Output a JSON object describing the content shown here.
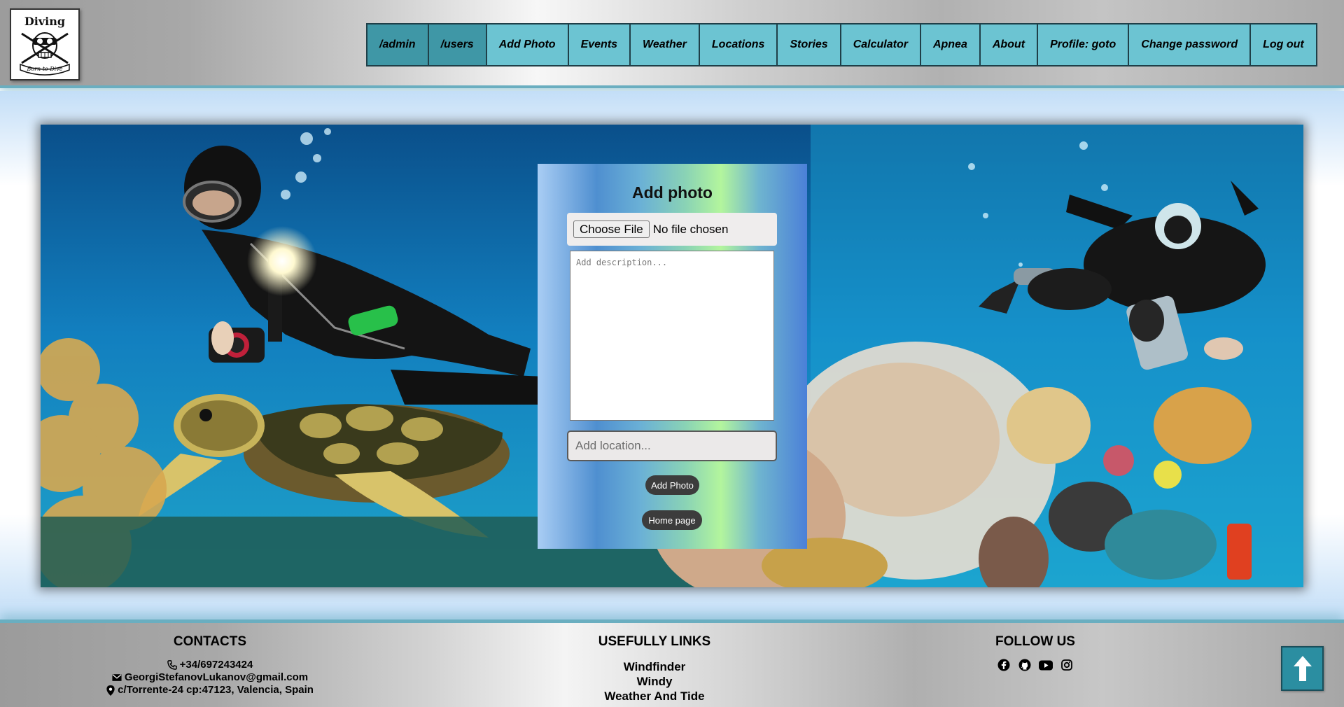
{
  "logo": {
    "alt": "Diving - Born to Dive",
    "top_text": "Diving",
    "bottom_text": "Born to Dive"
  },
  "nav": {
    "items": [
      {
        "label": "/admin",
        "name": "nav-admin"
      },
      {
        "label": "/users",
        "name": "nav-users"
      },
      {
        "label": "Add Photo",
        "name": "nav-add-photo"
      },
      {
        "label": "Events",
        "name": "nav-events"
      },
      {
        "label": "Weather",
        "name": "nav-weather"
      },
      {
        "label": "Locations",
        "name": "nav-locations"
      },
      {
        "label": "Stories",
        "name": "nav-stories"
      },
      {
        "label": "Calculator",
        "name": "nav-calculator"
      },
      {
        "label": "Apnea",
        "name": "nav-apnea"
      },
      {
        "label": "About",
        "name": "nav-about"
      },
      {
        "label": "Profile: goto",
        "name": "nav-profile"
      },
      {
        "label": "Change password",
        "name": "nav-change-password"
      },
      {
        "label": "Log out",
        "name": "nav-log-out"
      }
    ]
  },
  "form": {
    "title": "Add photo",
    "file_button": "Choose File",
    "file_status": "No file chosen",
    "description_placeholder": "Add description...",
    "location_placeholder": "Add location...",
    "submit_label": "Add Photo",
    "home_label": "Home page"
  },
  "footer": {
    "contacts": {
      "title": "CONTACTS",
      "phone": "+34/697243424",
      "email": "GeorgiStefanovLukanov@gmail.com",
      "address": "c/Torrente-24 cp:47123, Valencia, Spain"
    },
    "links": {
      "title": "USEFULLY LINKS",
      "items": [
        "Windfinder",
        "Windy",
        "Weather And Tide"
      ]
    },
    "follow": {
      "title": "FOLLOW US",
      "icons": [
        "facebook-icon",
        "github-icon",
        "youtube-icon",
        "instagram-icon"
      ]
    }
  },
  "colors": {
    "nav_bg": "#6cc4d2",
    "nav_active_bg": "#3f97a6",
    "accent": "#2b8ea1"
  }
}
